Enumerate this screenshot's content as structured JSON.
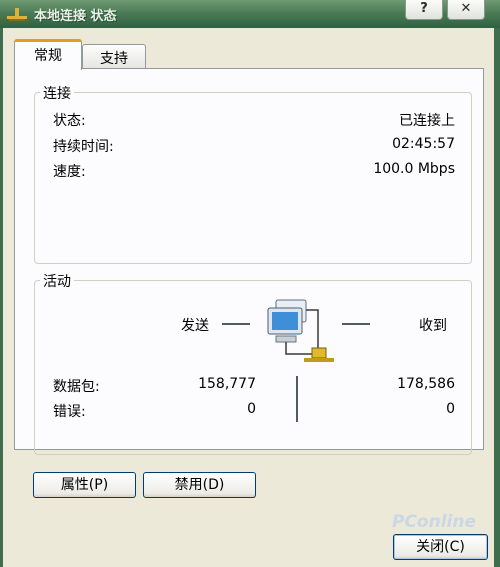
{
  "window": {
    "title": "本地连接 状态"
  },
  "titlebar": {
    "help_label": "?",
    "close_label": "✕"
  },
  "tabs": [
    {
      "label": "常规",
      "active": true
    },
    {
      "label": "支持",
      "active": false
    }
  ],
  "connection": {
    "legend": "连接",
    "status_label": "状态:",
    "status_value": "已连接上",
    "duration_label": "持续时间:",
    "duration_value": "02:45:57",
    "speed_label": "速度:",
    "speed_value": "100.0 Mbps"
  },
  "activity": {
    "legend": "活动",
    "sent_label": "发送",
    "received_label": "收到",
    "packets_label": "数据包:",
    "packets_sent": "158,777",
    "packets_received": "178,586",
    "errors_label": "错误:",
    "errors_sent": "0",
    "errors_received": "0"
  },
  "buttons": {
    "properties": "属性(P)",
    "disable": "禁用(D)",
    "close": "关闭(C)"
  },
  "watermark": "PConline",
  "icons": [
    "network-adapter-icon",
    "network-computer-icon"
  ]
}
